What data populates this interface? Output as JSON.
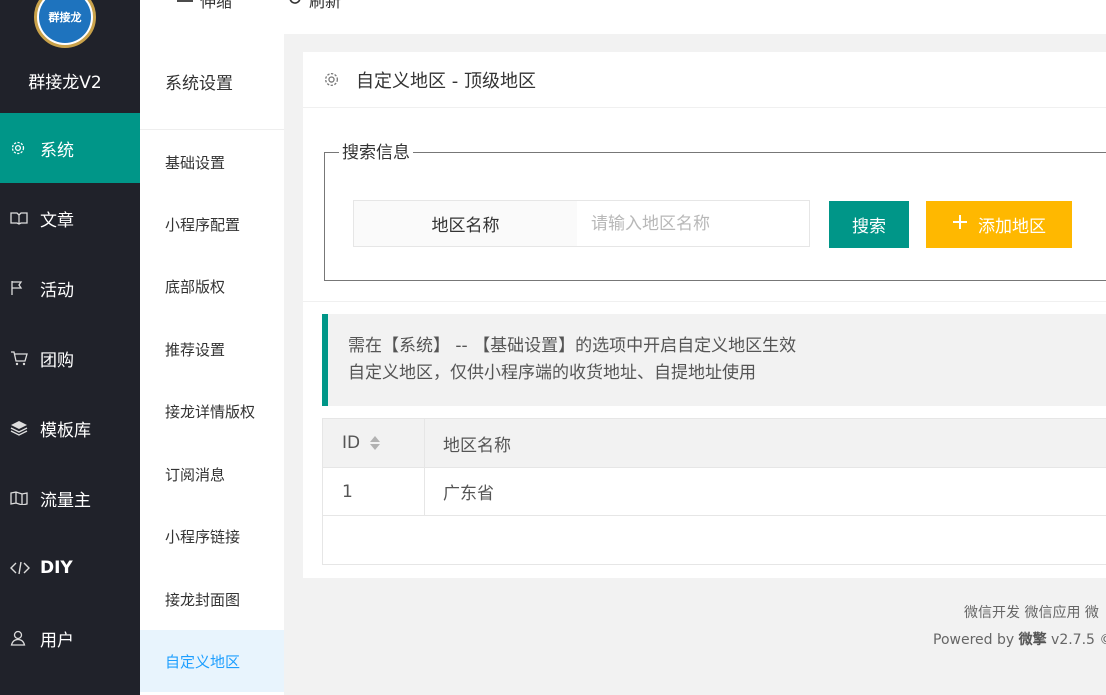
{
  "brand": {
    "logo_text": "群接龙",
    "name": "群接龙V2"
  },
  "topbar": {
    "collapse_label": "伸缩",
    "refresh_label": "刷新"
  },
  "nav": {
    "items": [
      {
        "label": "系统",
        "icon": "gear-icon",
        "active": true
      },
      {
        "label": "文章",
        "icon": "book-icon"
      },
      {
        "label": "活动",
        "icon": "flag-icon"
      },
      {
        "label": "团购",
        "icon": "cart-icon"
      },
      {
        "label": "模板库",
        "icon": "layers-icon"
      },
      {
        "label": "流量主",
        "icon": "map-icon"
      },
      {
        "label": "DIY",
        "icon": "code-icon"
      },
      {
        "label": "用户",
        "icon": "user-icon"
      }
    ]
  },
  "submenu": {
    "title": "系统设置",
    "items": [
      {
        "label": "基础设置"
      },
      {
        "label": "小程序配置"
      },
      {
        "label": "底部版权"
      },
      {
        "label": "推荐设置"
      },
      {
        "label": "接龙详情版权"
      },
      {
        "label": "订阅消息"
      },
      {
        "label": "小程序链接"
      },
      {
        "label": "接龙封面图"
      },
      {
        "label": "自定义地区",
        "active": true
      }
    ]
  },
  "page": {
    "title": "自定义地区 - 顶级地区",
    "search": {
      "legend": "搜索信息",
      "field_label": "地区名称",
      "placeholder": "请输入地区名称",
      "value": "",
      "search_button": "搜索",
      "add_button": "添加地区"
    },
    "notice": {
      "line1": "需在【系统】 -- 【基础设置】的选项中开启自定义地区生效",
      "line2": "自定义地区，仅供小程序端的收货地址、自提地址使用"
    },
    "table": {
      "columns": [
        "ID",
        "地区名称"
      ],
      "rows": [
        {
          "id": "1",
          "name": "广东省"
        }
      ]
    }
  },
  "footer": {
    "links": "微信开发 微信应用 微",
    "powered_prefix": "Powered by ",
    "powered_name": "微擎",
    "powered_version": " v2.7.5 ©"
  },
  "colors": {
    "primary": "#009688",
    "warning": "#ffb800",
    "nav_bg": "#20222a",
    "submenu_active": "#1e9fff"
  }
}
